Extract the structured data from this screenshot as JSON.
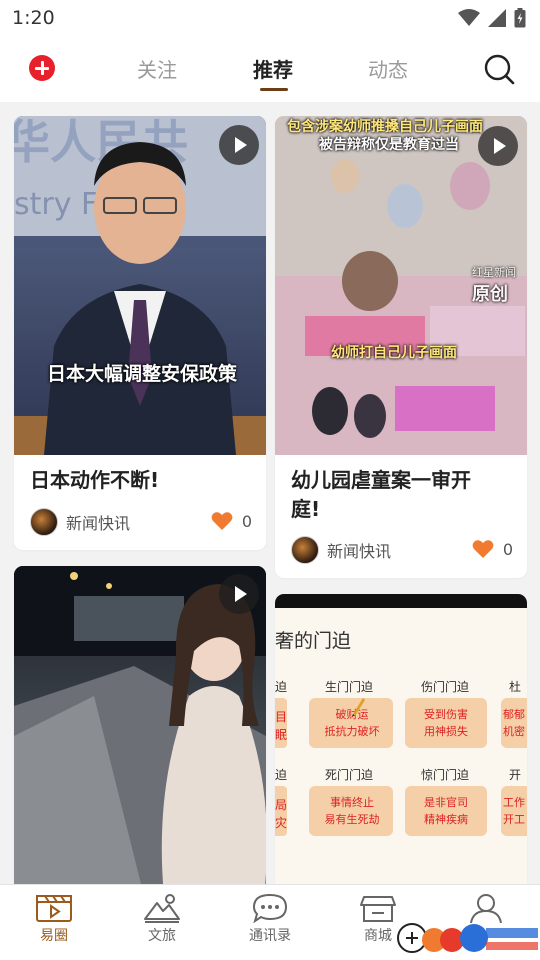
{
  "status_bar": {
    "time": "1:20"
  },
  "top_nav": {
    "tabs": [
      {
        "label": "关注",
        "active": false
      },
      {
        "label": "推荐",
        "active": true
      },
      {
        "label": "动态",
        "active": false
      }
    ]
  },
  "feed": [
    {
      "title": "日本动作不断!",
      "overlay_caption": "日本大幅调整安保政策",
      "author": "新闻快讯",
      "likes": "0"
    },
    {
      "title_line1": "幼儿园虐童案一审开",
      "title_line2": "庭!",
      "overlay_caption_top_1": "包含涉案幼师推搡自己儿子画面",
      "overlay_caption_top_2": "被告辩称仅是教育过当",
      "overlay_caption_mid": "幼师打自己儿子画面",
      "overlay_watermark_1": "红星新闻",
      "overlay_watermark_2": "原创",
      "author": "新闻快讯",
      "likes": "0"
    },
    {
      "title": ""
    },
    {
      "board_heading": "奢的门迫",
      "board_cells_top": [
        "生门门迫",
        "伤门门迫",
        "杜门"
      ],
      "board_notes_top": [
        "破财运\n抵抗力破坏",
        "受到伤害\n用神损失",
        "郁郁\n机密"
      ],
      "board_cells_bottom": [
        "死门门迫",
        "惊门门迫",
        "开门"
      ],
      "board_notes_bottom": [
        "事情终止\n易有生死劫",
        "是非官司\n精神疾病",
        "工作\n开工"
      ],
      "board_left_col_top": [
        "迫",
        "目",
        "眠"
      ],
      "board_left_col_bottom": [
        "迫",
        "局",
        "灾"
      ]
    }
  ],
  "bottom_nav": {
    "items": [
      {
        "label": "易圈",
        "active": true
      },
      {
        "label": "文旅",
        "active": false
      },
      {
        "label": "通讯录",
        "active": false
      },
      {
        "label": "商城",
        "active": false
      }
    ]
  },
  "colors": {
    "accent_brown": "#9a5b1c",
    "plus_red": "#e8202c",
    "heart_orange": "#f07a30"
  }
}
